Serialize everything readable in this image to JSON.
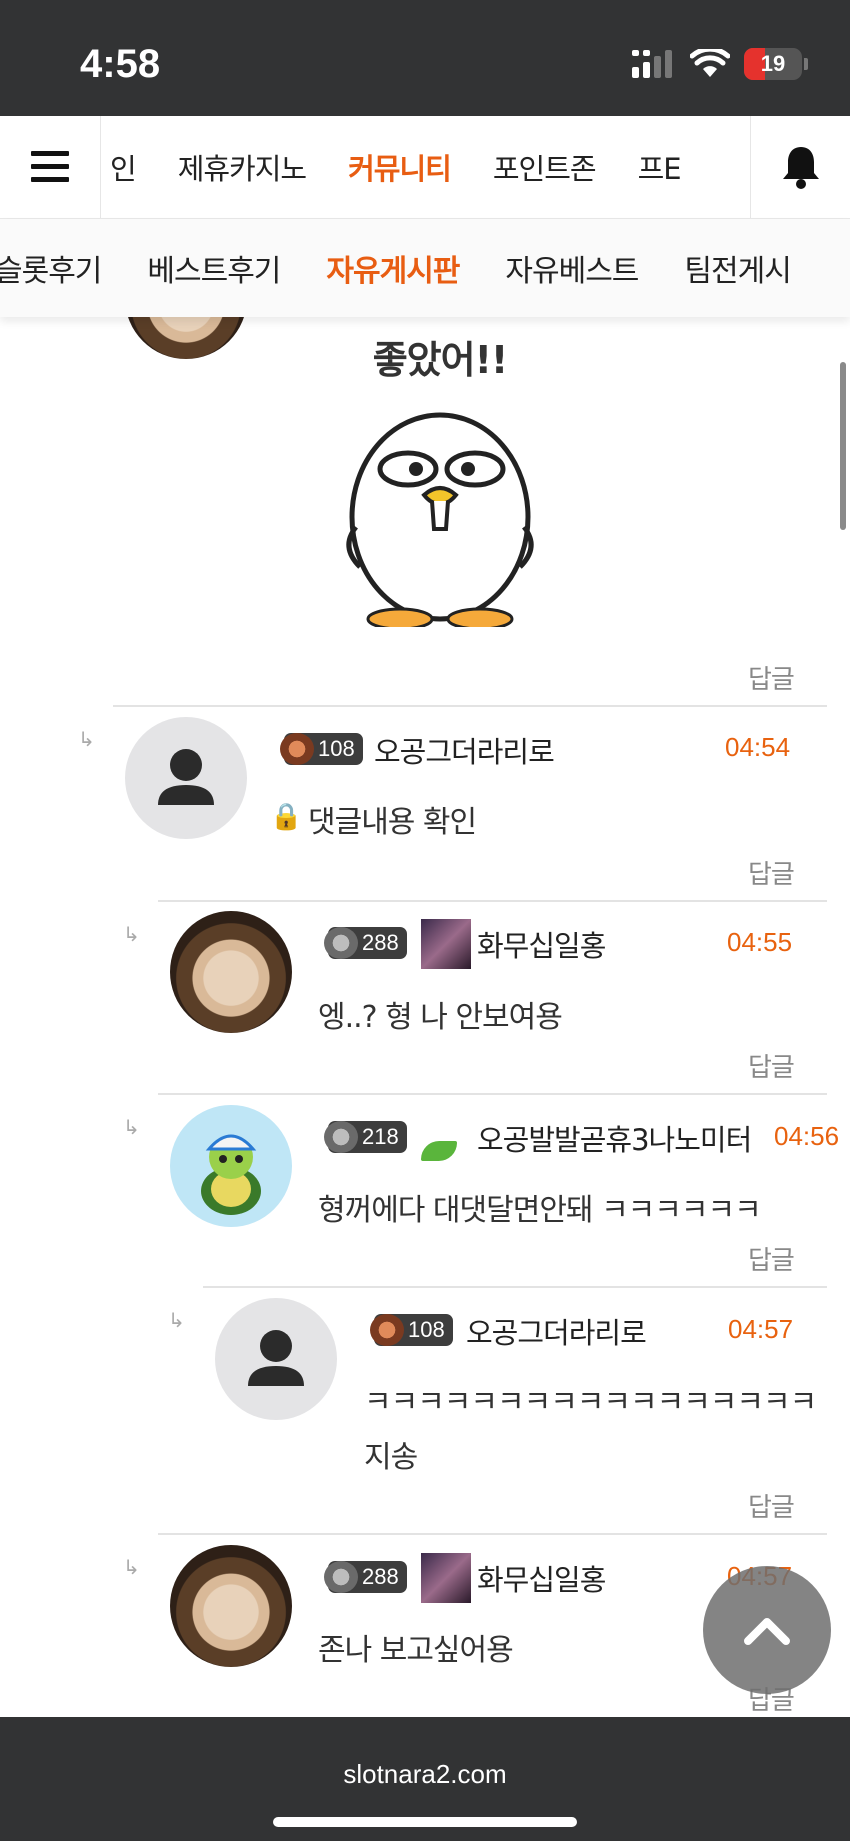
{
  "status_bar": {
    "time": "4:58",
    "battery": "19"
  },
  "top_nav": {
    "items": [
      "인",
      "제휴카지노",
      "커뮤니티",
      "포인트존",
      "프E"
    ],
    "active_index": 2
  },
  "sub_nav": {
    "items": [
      "슬롯후기",
      "베스트후기",
      "자유게시판",
      "자유베스트",
      "팀전게시"
    ],
    "active_index": 2
  },
  "sticker": {
    "caption": "좋았어!!"
  },
  "comments": [
    {
      "reply_label": "답글"
    },
    {
      "level": "108",
      "nickname": "오공그더라리로",
      "time": "04:54",
      "lock_icon": "lock-icon",
      "message": "댓글내용 확인",
      "reply_label": "답글"
    },
    {
      "level": "288",
      "nickname": "화무십일홍",
      "time": "04:55",
      "message": "엥..? 형 나 안보여용",
      "reply_label": "답글"
    },
    {
      "level": "218",
      "nickname": "오공발발곧휴3나노미터",
      "time": "04:56",
      "message": "형꺼에다 대댓달면안돼 ㅋㅋㅋㅋㅋㅋ",
      "reply_label": "답글"
    },
    {
      "level": "108",
      "nickname": "오공그더라리로",
      "time": "04:57",
      "message_line1": "ㅋㅋㅋㅋㅋㅋㅋㅋㅋㅋㅋㅋㅋㅋㅋㅋㅋ",
      "message_line2": "지송",
      "reply_label": "답글"
    },
    {
      "level": "288",
      "nickname": "화무십일홍",
      "time": "04:57",
      "message": "존나 보고싶어용",
      "reply_label": "답글"
    }
  ],
  "browser": {
    "url": "slotnara2.com"
  },
  "colors": {
    "accent": "#e85d12",
    "time": "#e8620f",
    "bars": "#323334"
  }
}
